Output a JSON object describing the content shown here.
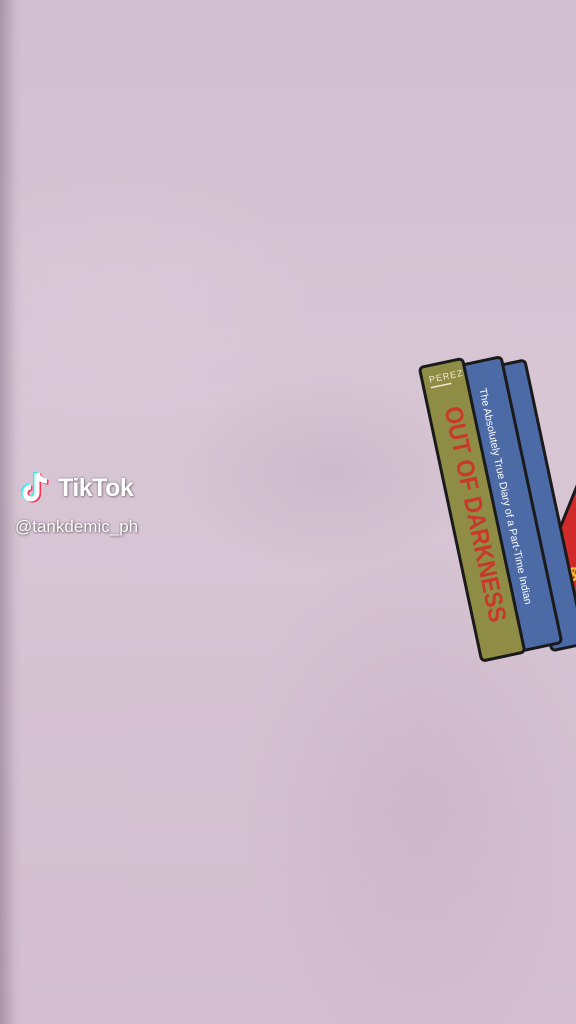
{
  "watermark": {
    "brand": "TikTok",
    "handle": "@tankdemic_ph",
    "logo_icon": "tiktok-note-icon"
  },
  "shirt_print": {
    "books": [
      {
        "spine_top": "PEREZ",
        "title": "OUT OF DARKNESS",
        "color": "#8f8d45",
        "text_color": "#c8392b"
      },
      {
        "title": "The Absolutely True Diary of a Part-Time Indian",
        "color": "#4b6aa6",
        "text_color": "#ffffff"
      },
      {
        "title": "",
        "color": "#4b6aa6"
      },
      {
        "title": "",
        "color": "#d22a2a",
        "text_color": "#f2c232"
      }
    ],
    "shirt_color": "#d6c3d2"
  }
}
